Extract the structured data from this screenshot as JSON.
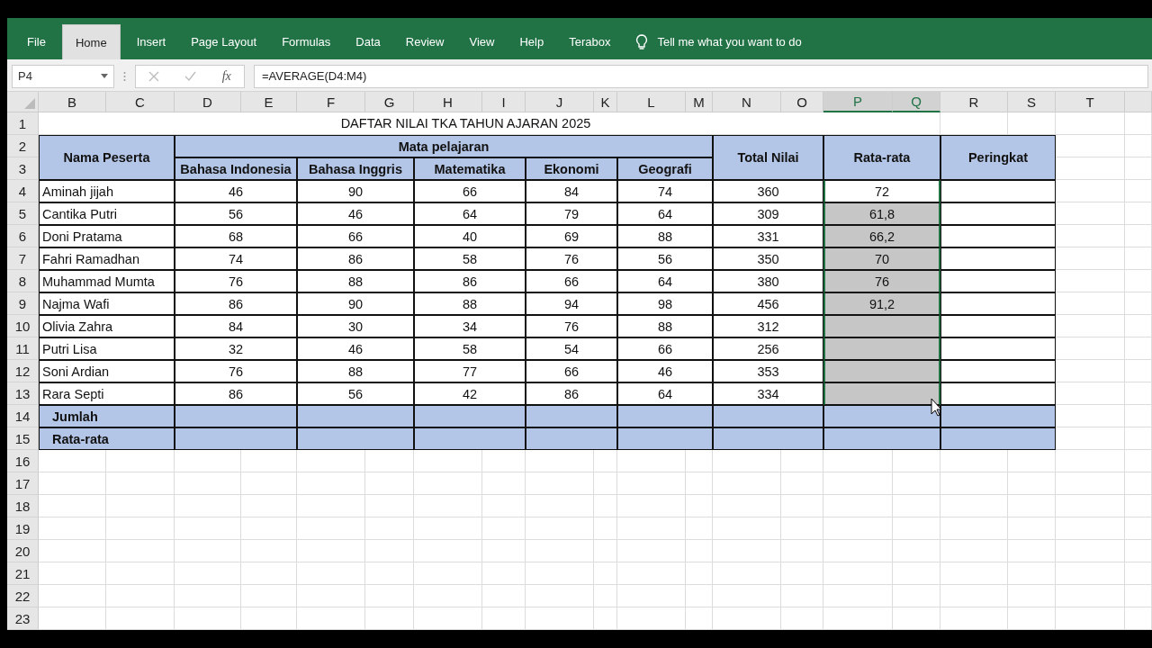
{
  "ribbon": {
    "tabs": [
      {
        "label": "File",
        "selected": false
      },
      {
        "label": "Home",
        "selected": true
      },
      {
        "label": "Insert",
        "selected": false
      },
      {
        "label": "Page Layout",
        "selected": false
      },
      {
        "label": "Formulas",
        "selected": false
      },
      {
        "label": "Data",
        "selected": false
      },
      {
        "label": "Review",
        "selected": false
      },
      {
        "label": "View",
        "selected": false
      },
      {
        "label": "Help",
        "selected": false
      },
      {
        "label": "Terabox",
        "selected": false
      }
    ],
    "tell_me": "Tell me what you want to do"
  },
  "formula_bar": {
    "name_box": "P4",
    "fx": "fx",
    "formula": "=AVERAGE(D4:M4)"
  },
  "column_headers": [
    {
      "label": "B",
      "selected": false
    },
    {
      "label": "C",
      "selected": false
    },
    {
      "label": "D",
      "selected": false
    },
    {
      "label": "E",
      "selected": false
    },
    {
      "label": "F",
      "selected": false
    },
    {
      "label": "G",
      "selected": false
    },
    {
      "label": "H",
      "selected": false
    },
    {
      "label": "I",
      "selected": false
    },
    {
      "label": "J",
      "selected": false
    },
    {
      "label": "K",
      "selected": false
    },
    {
      "label": "L",
      "selected": false
    },
    {
      "label": "M",
      "selected": false
    },
    {
      "label": "N",
      "selected": false
    },
    {
      "label": "O",
      "selected": false
    },
    {
      "label": "P",
      "selected": true
    },
    {
      "label": "Q",
      "selected": true
    },
    {
      "label": "R",
      "selected": false
    },
    {
      "label": "S",
      "selected": false
    },
    {
      "label": "T",
      "selected": false
    }
  ],
  "row_numbers": [
    "1",
    "2",
    "3",
    "4",
    "5",
    "6",
    "7",
    "8",
    "9",
    "10",
    "11",
    "12",
    "13",
    "14",
    "15",
    "16",
    "17",
    "18",
    "19",
    "20",
    "21",
    "22",
    "23"
  ],
  "sheet": {
    "title": "DAFTAR NILAI TKA TAHUN AJARAN 2025",
    "name_header": "Nama Peserta",
    "subjects_header": "Mata pelajaran",
    "subjects": [
      "Bahasa Indonesia",
      "Bahasa Inggris",
      "Matematika",
      "Ekonomi",
      "Geografi"
    ],
    "total_header": "Total Nilai",
    "average_header": "Rata-rata",
    "rank_header": "Peringkat",
    "students": [
      {
        "name": "Aminah jijah",
        "scores": [
          "46",
          "90",
          "66",
          "84",
          "74"
        ],
        "total": "360",
        "average": "72",
        "selected": true,
        "active": true
      },
      {
        "name": "Cantika Putri",
        "scores": [
          "56",
          "46",
          "64",
          "79",
          "64"
        ],
        "total": "309",
        "average": "61,8",
        "selected": true,
        "active": false
      },
      {
        "name": "Doni Pratama",
        "scores": [
          "68",
          "66",
          "40",
          "69",
          "88"
        ],
        "total": "331",
        "average": "66,2",
        "selected": true,
        "active": false
      },
      {
        "name": "Fahri Ramadhan",
        "scores": [
          "74",
          "86",
          "58",
          "76",
          "56"
        ],
        "total": "350",
        "average": "70",
        "selected": true,
        "active": false
      },
      {
        "name": "Muhammad Mumta",
        "scores": [
          "76",
          "88",
          "86",
          "66",
          "64"
        ],
        "total": "380",
        "average": "76",
        "selected": true,
        "active": false
      },
      {
        "name": "Najma Wafi",
        "scores": [
          "86",
          "90",
          "88",
          "94",
          "98"
        ],
        "total": "456",
        "average": "91,2",
        "selected": true,
        "active": false
      },
      {
        "name": "Olivia Zahra",
        "scores": [
          "84",
          "30",
          "34",
          "76",
          "88"
        ],
        "total": "312",
        "selected": true,
        "active": false
      },
      {
        "name": "Putri Lisa",
        "scores": [
          "32",
          "46",
          "58",
          "54",
          "66"
        ],
        "total": "256",
        "selected": true,
        "active": false
      },
      {
        "name": "Soni Ardian",
        "scores": [
          "76",
          "88",
          "77",
          "66",
          "46"
        ],
        "total": "353",
        "selected": true,
        "active": false
      },
      {
        "name": "Rara Septi",
        "scores": [
          "86",
          "56",
          "42",
          "86",
          "64"
        ],
        "total": "334",
        "selected": true,
        "active": false
      }
    ],
    "footer_rows": [
      "Jumlah",
      "Rata-rata"
    ]
  }
}
